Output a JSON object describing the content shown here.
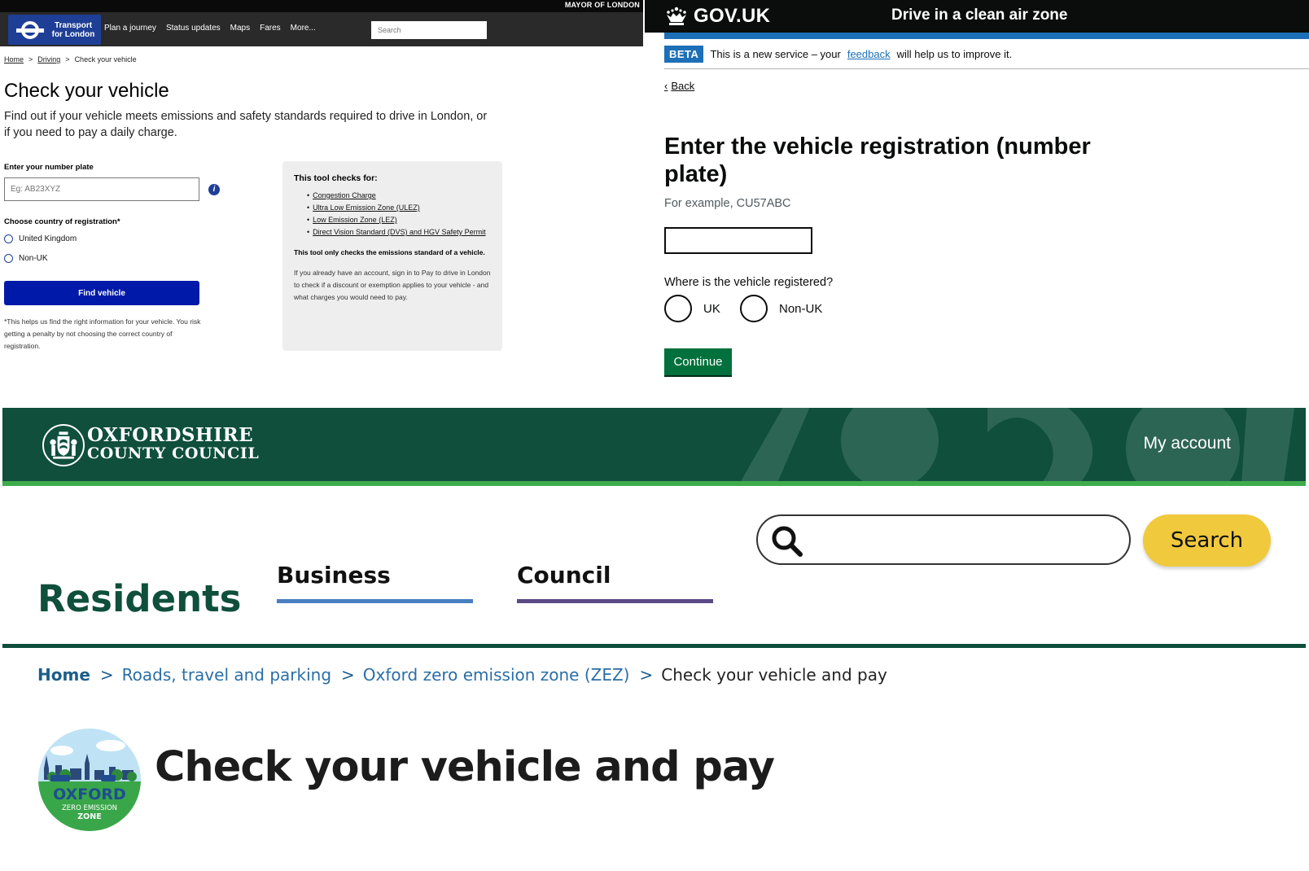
{
  "tfl": {
    "mayor": "MAYOR OF LONDON",
    "logo_line1": "Transport",
    "logo_line2": "for London",
    "nav": [
      "Plan a journey",
      "Status updates",
      "Maps",
      "Fares",
      "More..."
    ],
    "search_placeholder": "Search",
    "breadcrumb": [
      "Home",
      "Driving",
      "Check your vehicle"
    ],
    "breadcrumb_sep": ">",
    "title": "Check your vehicle",
    "intro": "Find out if your vehicle meets emissions and safety standards required to drive in London, or if you need to pay a daily charge.",
    "plate_label": "Enter your number plate",
    "plate_placeholder": "Eg: AB23XYZ",
    "info_glyph": "i",
    "country_label": "Choose country of registration*",
    "radio_uk": "United Kingdom",
    "radio_nonuk": "Non-UK",
    "find_button": "Find vehicle",
    "note": "*This helps us find the right information for your vehicle. You risk getting a penalty by not choosing the correct country of registration.",
    "box_title": "This tool checks for:",
    "box_items": [
      "Congestion Charge",
      "Ultra Low Emission Zone (ULEZ)",
      "Low Emission Zone (LEZ)",
      "Direct Vision Standard (DVS) and HGV Safety Permit"
    ],
    "box_bold": "This tool only checks the emissions standard of a vehicle.",
    "box_para": "If you already have an account, sign in to Pay to drive in London to check if a discount or exemption applies to your vehicle - and what charges you would need to pay.",
    "colors": {
      "brand": "#1f3f96",
      "button": "#0019a8"
    },
    "icons": {
      "logo": "tfl-roundel-icon",
      "info": "info-icon"
    }
  },
  "gov": {
    "logo": "GOV.UK",
    "service": "Drive in a clean air zone",
    "beta_tag": "BETA",
    "beta_before": "This is a new service – your",
    "beta_link": "feedback",
    "beta_after": "will help us to improve it.",
    "back": "Back",
    "back_glyph": "‹",
    "heading": "Enter the vehicle registration (number plate)",
    "hint": "For example, CU57ABC",
    "question": "Where is the vehicle registered?",
    "radio_uk": "UK",
    "radio_nonuk": "Non-UK",
    "continue": "Continue",
    "colors": {
      "header": "#0b0c0c",
      "blue": "#1d70b8",
      "green": "#00703c"
    },
    "icons": {
      "crown": "crown-icon",
      "back": "chevron-left-icon"
    }
  },
  "oxf": {
    "logo_line1": "OXFORDSHIRE",
    "logo_line2": "COUNTY COUNCIL",
    "account": "My account",
    "search_button": "Search",
    "residents": "Residents",
    "tab_business": "Business",
    "tab_council": "Council",
    "breadcrumb": [
      "Home",
      "Roads, travel and parking",
      "Oxford zero emission zone (ZEZ)",
      "Check your vehicle and pay"
    ],
    "breadcrumb_sep": ">",
    "badge_line1": "OXFORD",
    "badge_line2": "ZERO EMISSION",
    "badge_line3": "ZONE",
    "title": "Check your vehicle and pay",
    "colors": {
      "header": "#0f4f3c",
      "accent": "#3eac4b",
      "search": "#f0c93d",
      "business": "#4a7fc1",
      "council": "#5a4a86"
    },
    "icons": {
      "crest": "council-crest-icon",
      "search": "search-icon",
      "zez": "zez-badge-icon"
    }
  }
}
